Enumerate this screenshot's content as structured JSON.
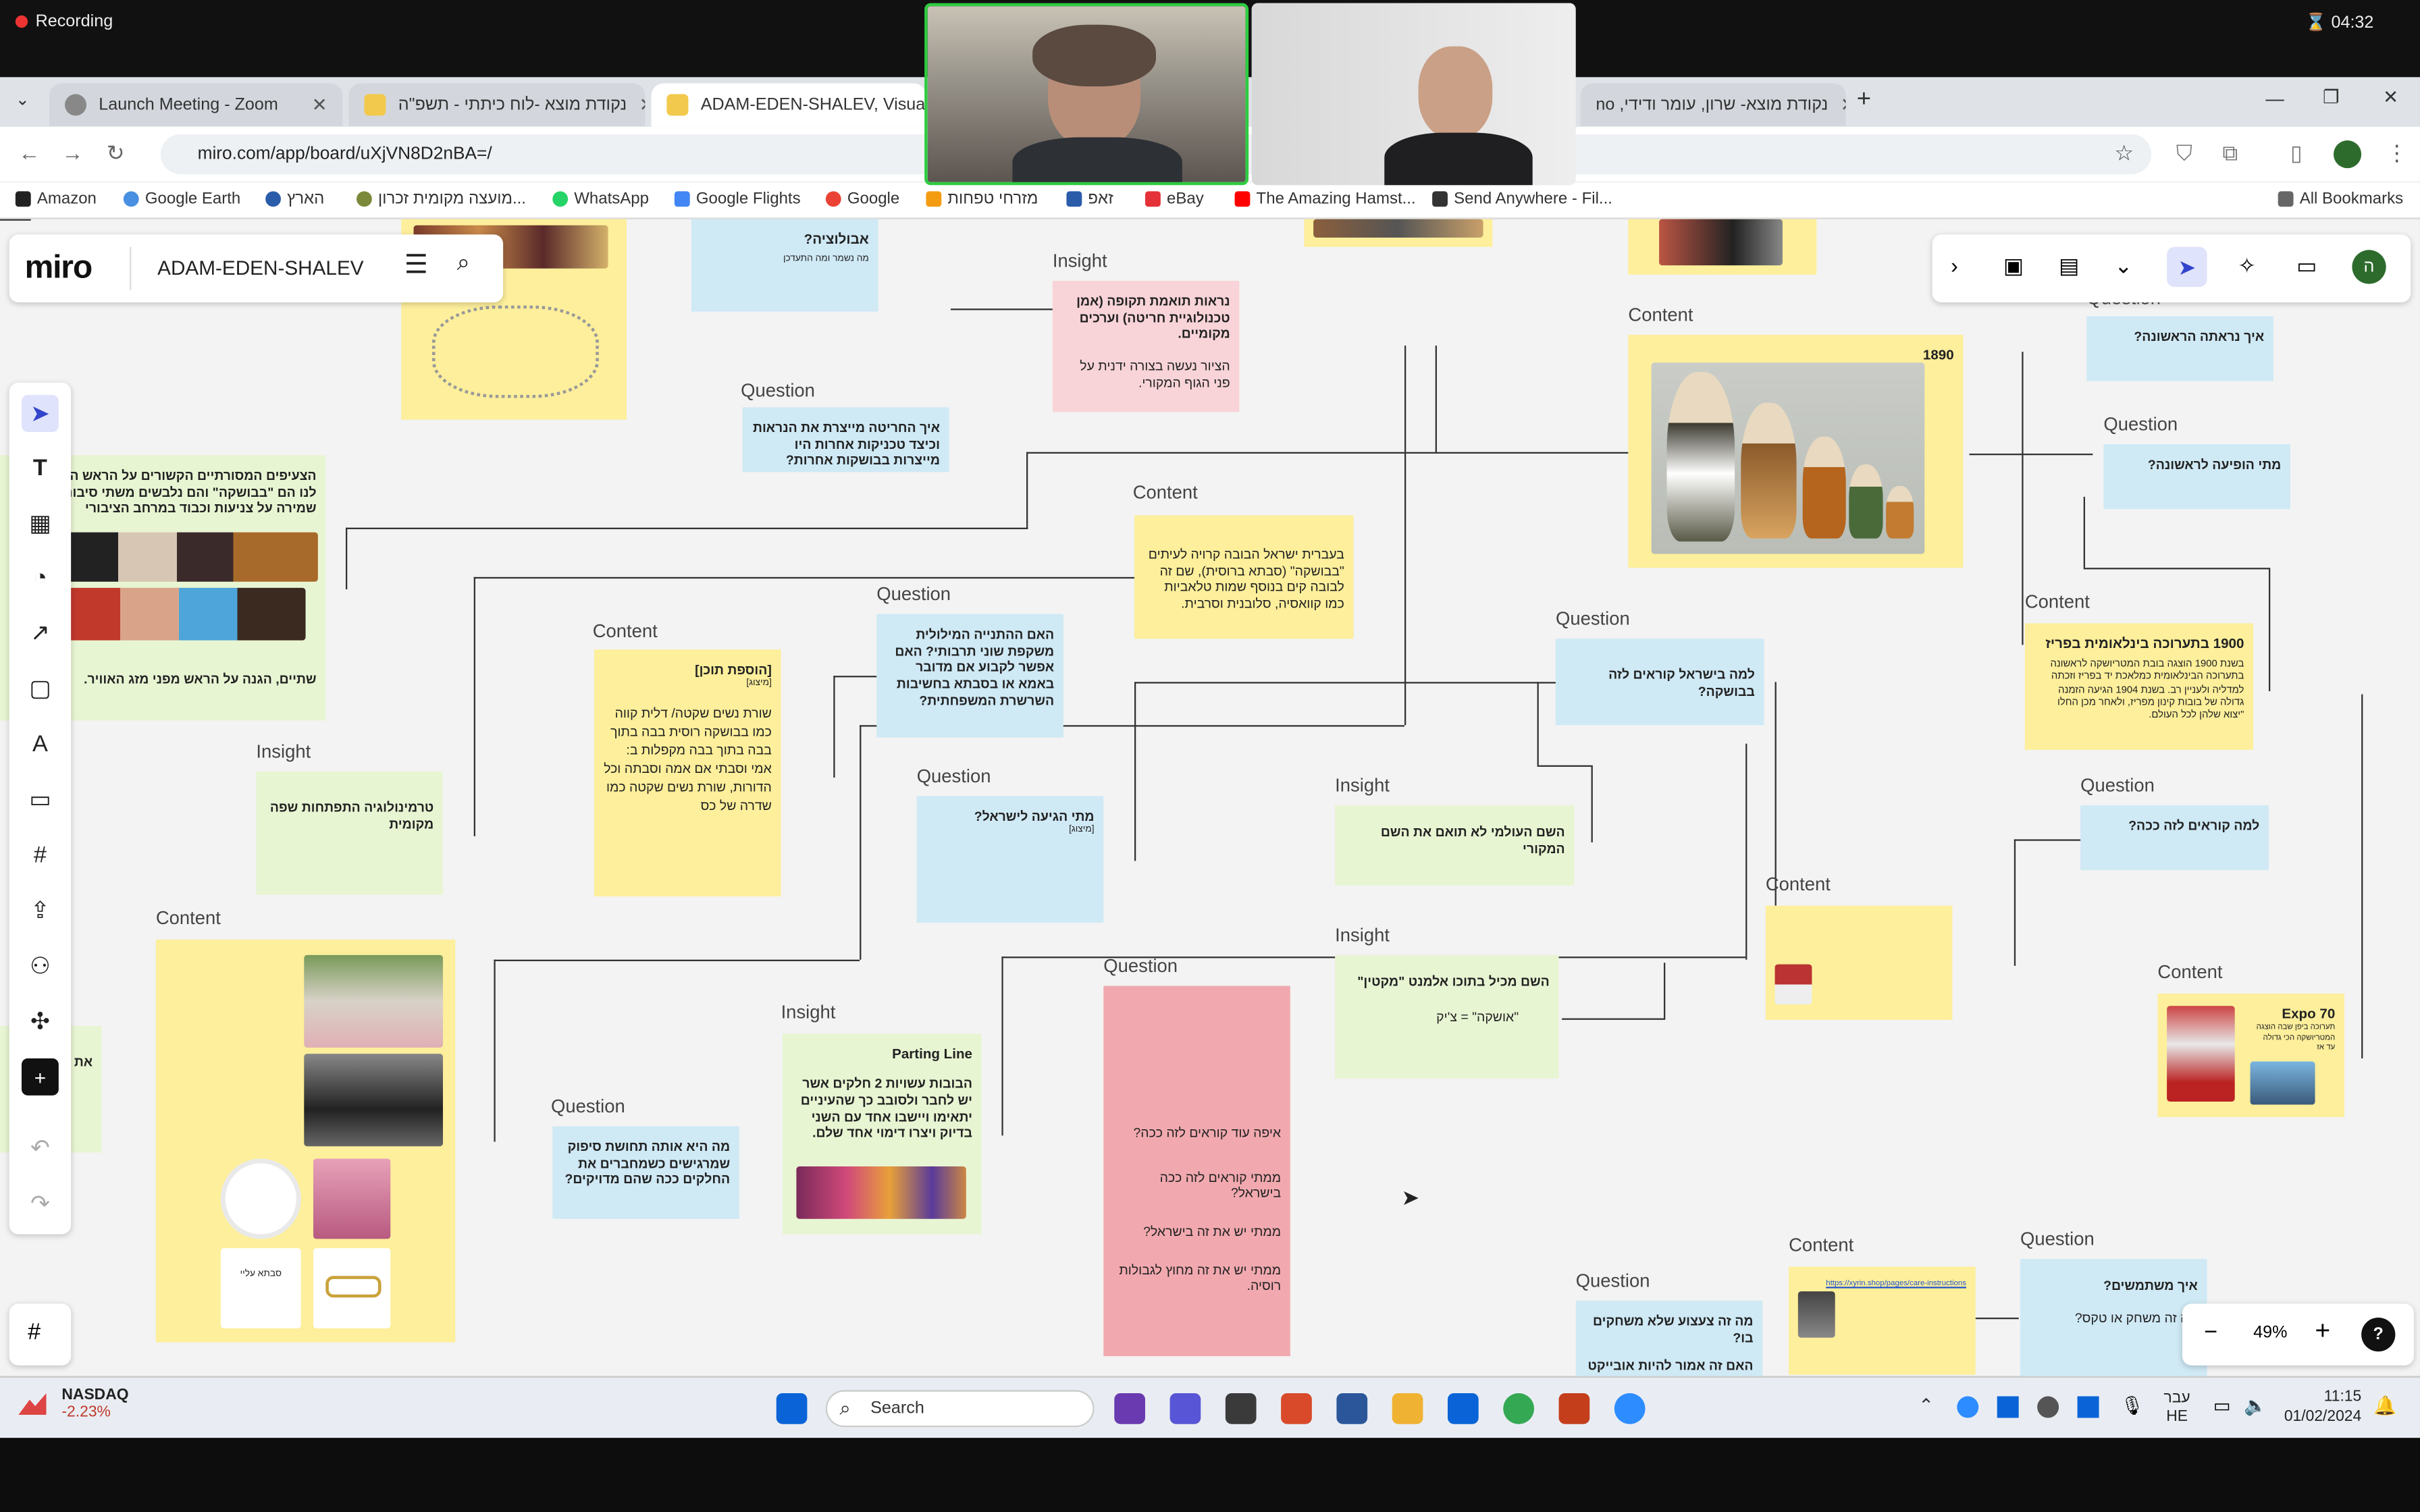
{
  "recording": {
    "label": "Recording",
    "timer": "04:32"
  },
  "tabs": [
    {
      "label": "Launch Meeting - Zoom",
      "color": "#888888"
    },
    {
      "label": "נקודת מוצא -לוח כיתתי - תשפ\"ה",
      "color": "#f2c94c"
    },
    {
      "label": "ADAM-EDEN-SHALEV, Visual W",
      "color": "#f2c94c"
    },
    {
      "label": "נקודת מוצא- שרון, עומר ודידי, ‮on",
      "color": "#f2c94c"
    }
  ],
  "address": {
    "url": "miro.com/app/board/uXjVN8D2nBA=/"
  },
  "bookmarks": [
    {
      "label": "Amazon"
    },
    {
      "label": "Google Earth"
    },
    {
      "label": "הארץ"
    },
    {
      "label": "מועצה מקומית זכרון..."
    },
    {
      "label": "WhatsApp"
    },
    {
      "label": "Google Flights"
    },
    {
      "label": "Google"
    },
    {
      "label": "מזרחי טפחות"
    },
    {
      "label": "זאפ"
    },
    {
      "label": "eBay"
    },
    {
      "label": "The Amazing Hamst..."
    },
    {
      "label": "Send Anywhere - Fil..."
    },
    {
      "label": "All Bookmarks"
    }
  ],
  "miro": {
    "logo": "miro",
    "board": "ADAM-EDEN-SHALEV",
    "avatar": "ה"
  },
  "zoom": {
    "level": "49%",
    "minus": "−",
    "plus": "+",
    "help": "?"
  },
  "labels": {
    "insight": "Insight",
    "question": "Question",
    "content": "Content"
  },
  "notes": {
    "n_abolutzia": "אבולוציה?",
    "n_abolutzia_sub": "מה נשמר ומה התעדכן",
    "n_insight1": "נראות תואמת תקופה (אמן טכנולוגיית חריטה) וערכים מקומיים.",
    "n_insight1_sub": "הציור נעשה בצורה ידנית על פני הגוף המקורי.",
    "n_q_engraving": "איך החריטה מייצרת את הנראות וכיצד טכניקות אחרות היו מייצרות בבושקות אחרות?",
    "n_1890": "1890",
    "n_q_how": "איך נראתה הראשונה?",
    "n_q_when": "מתי הופיעה לראשונה?",
    "n_scarves": "הצעיפים המסורתיים הקשורים על הראש המוכרים לנו הם \"בבושקה\" והם נלבשים משתי סיבות. אחת, שמירה על צניעות וכבוד במרחב הציבורי",
    "n_scarves_2": "שתיים, הגנה על הראש מפני מזג האוויר.",
    "n_content_israel": "בעברית ישראל הבובה קרויה לעיתים \"בבושקה\" (סבתא ברוסית), שם זה לבובה קים בנוסף שמות טלאביות כמו קוואסיה, סלובנית וסרבית.",
    "n_q_family": "האם ההתנייה המילולית משקפת שוני תרבותי? האם אפשר לקבוע אם מדובר באמא או בסבתא בחשיבות השרשרת המשפחתית?",
    "n_add_content_title": "[הוספת תוכן]",
    "n_add_content_sub": "[מיצוג]",
    "n_add_content": "שורת נשים שקטה/ דלית קווה כמו בבושקה רוסית בבה בתוך בבה בתוך בבה מקפלות ב: אמי וסבתי אם אמה וסבתה וכל הדורות, שורת נשים שקטה כמו שדרה של כס",
    "n_1900_title": "1900 בתערוכה בינלאומית בפריז",
    "n_1900": "בשנת 1900 הוצגה בובת המטריושקה לראשונה בתערוכה הבינלאומית כמלאכת יד בפריז וזכתה למדליה ולעניין רב. בשנת 1904 הגיעה הזמנה גדולה של בובות קינון מפריז, ולאחר מכן החלו \"יצוא שלהן לכל העולם.",
    "n_q_why_israel": "למה בישראל קוראים לזה בבושקה?",
    "n_q_when_israel": "מתי הגיעה לישראל?",
    "n_q_when_israel_sub": "[מיצוג]",
    "n_insight_term": "טרמינולוגיה התפתחות שפה מקומית",
    "n_insight_name": "השם העולמי לא תואם את השם המקורי",
    "n_q_why_called": "למה קוראים לזה ככה?",
    "n_insight_tiny": "השם מכיל בתוכו אלמנט \"מקטין\"",
    "n_insight_tiny_2": "\"אושקה\" = צ'יק",
    "n_expo": "Expo 70",
    "n_expo_sub": "תערוכה ביפן שבה הוצגה המטריושקה הכי גדולה עד אז",
    "n_parting_title": "Parting Line",
    "n_parting": "הבובות עשויות 2 חלקים אשר יש לחבר ולסובב כך שהעיניים יתאימו ויישבו אחד עם השני בדיוק ויצרו דימוי אחד שלם.",
    "n_q_story": "מה היא אותה תחושת סיפוק שמרגישים כשמחברים את החלקים ככה שהם מדויקים?",
    "n_q_red1": "איפה עוד קוראים לזה ככה?",
    "n_q_red2": "ממתי קוראים לזה ככה בישראל?",
    "n_q_red3": "ממתי יש את זה בישראל?",
    "n_q_red4": "ממתי יש את זה מחוץ לגבולות רוסיה.",
    "n_q_play": "מה זה צעצוע שלא משחקים בו?",
    "n_q_play2": "האם זה אמור להיות אובייקט נוייה?",
    "n_q_use": "איך משתמשים?",
    "n_q_use2": "מה זה משחק או טקס?",
    "n_link": "https://xyrin.shop/pages/care-instructions",
    "n_small_sticker": "סבתא עליי",
    "n_cut_left": "את"
  },
  "taskbar": {
    "nasdaq": "NASDAQ",
    "nasdaq_change": "-2.23%",
    "search": "Search",
    "lang": "עבר",
    "lang2": "HE",
    "time": "11:15",
    "date": "01/02/2024"
  }
}
